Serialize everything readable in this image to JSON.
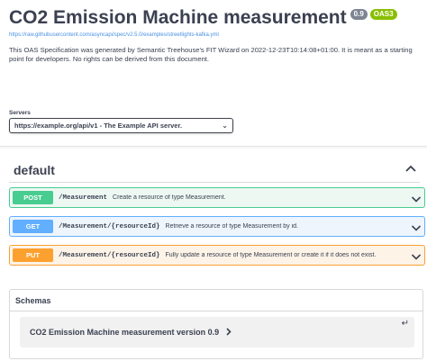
{
  "info": {
    "title": "CO2 Emission Machine measurement",
    "version": "0.9",
    "oas_badge": "OAS3",
    "spec_url": "https://raw.githubusercontent.com/asyncapi/spec/v2.5.0/examples/streetlights-kafka.yml",
    "description": "This OAS Specification was generated by Semantic Treehouse's FIT Wizard on 2022-12-23T10:14:08+01:00. It is meant as a starting point for developers. No rights can be derived from this document."
  },
  "servers": {
    "label": "Servers",
    "selected": "https://example.org/api/v1 - The Example API server."
  },
  "tag": {
    "name": "default"
  },
  "operations": [
    {
      "method": "POST",
      "path": "/Measurement",
      "summary": "Create a resource of type Measurement."
    },
    {
      "method": "GET",
      "path": "/Measurement/{resourceId}",
      "summary": "Retrieve a resource of type Measurement by id."
    },
    {
      "method": "PUT",
      "path": "/Measurement/{resourceId}",
      "summary": "Fully update a resource of type Measurement or create it if it does not exist."
    }
  ],
  "schemas": {
    "title": "Schemas",
    "models": [
      {
        "name": "CO2 Emission Machine measurement version 0.9"
      }
    ]
  },
  "colors": {
    "post": "#49cc90",
    "get": "#61affe",
    "put": "#fca130",
    "link": "#4990e2",
    "oas_badge": "#89bf04",
    "version_badge": "#7d8492"
  },
  "icons": {
    "tag_toggle": "chevron-up-icon",
    "operation_toggle": "chevron-down-icon",
    "model_expand": "chevron-right-icon",
    "model_return": "return-arrow-icon"
  }
}
